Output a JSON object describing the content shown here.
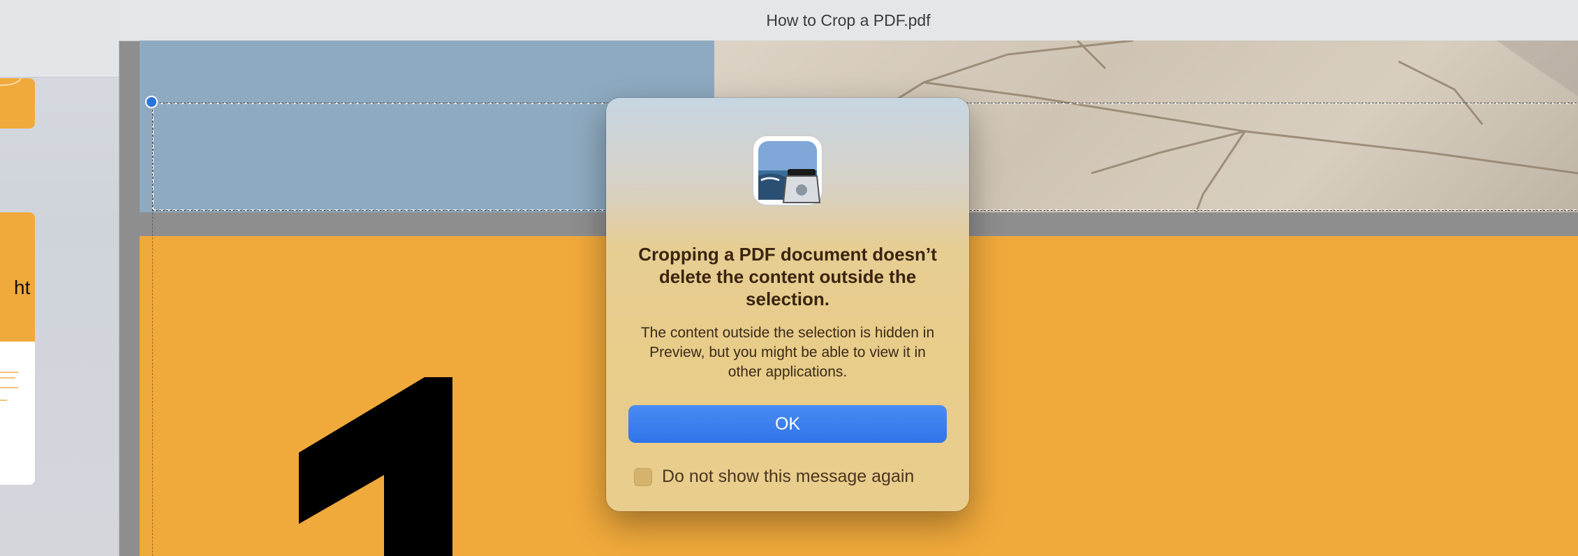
{
  "window": {
    "title": "How to Crop a PDF.pdf"
  },
  "sidebar": {
    "thumb2_partial_text": "ht"
  },
  "dialog": {
    "title": "Cropping a PDF document doesn’t delete the content outside the selection.",
    "message": "The content outside the selection is hidden in Preview, but you might be able to view it in other applications.",
    "ok_label": "OK",
    "checkbox_label": "Do not show this message again",
    "checkbox_checked": false,
    "app_icon": "preview-app-icon"
  },
  "colors": {
    "accent": "#2f74ea",
    "page_orange": "#f0a93b",
    "page_blue": "#8eaac0"
  }
}
